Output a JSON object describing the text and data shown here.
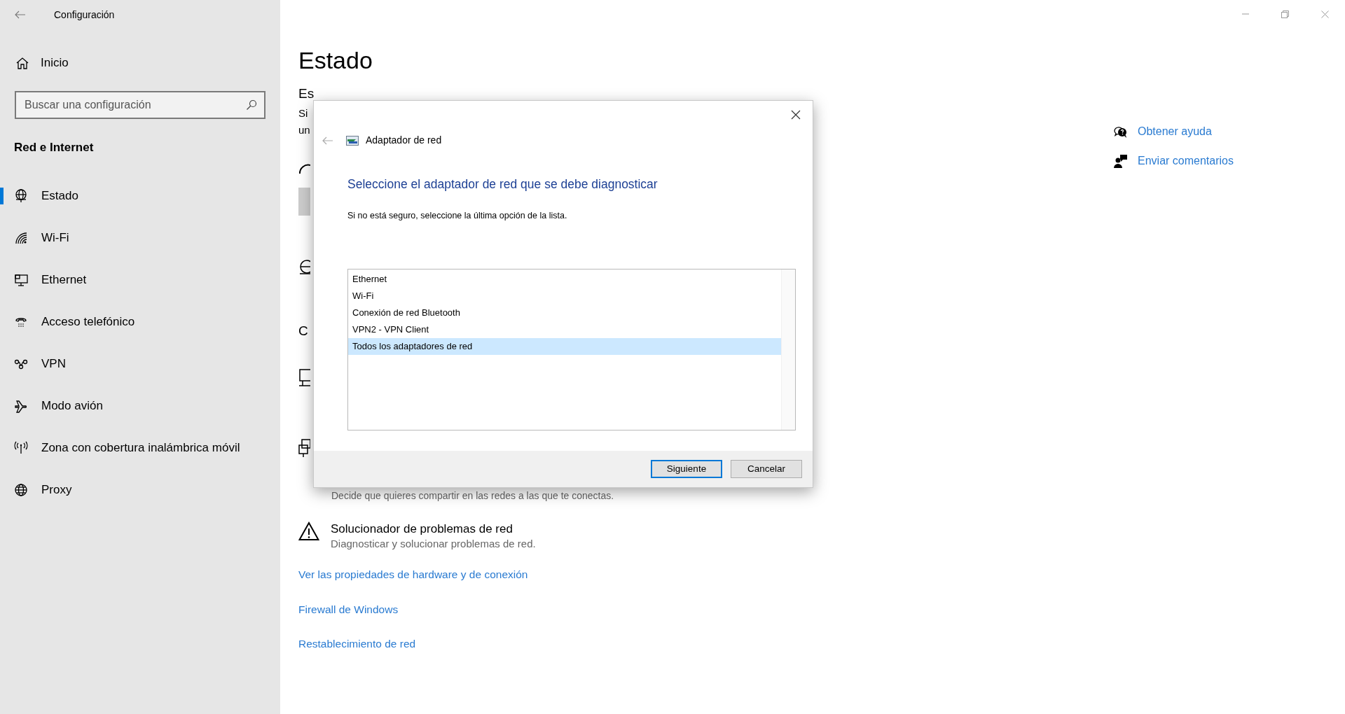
{
  "window": {
    "title": "Configuración"
  },
  "sidebar": {
    "home": "Inicio",
    "search": {
      "placeholder": "Buscar una configuración"
    },
    "section": "Red e Internet",
    "items": [
      {
        "label": "Estado",
        "selected": true
      },
      {
        "label": "Wi-Fi",
        "selected": false
      },
      {
        "label": "Ethernet",
        "selected": false
      },
      {
        "label": "Acceso telefónico",
        "selected": false
      },
      {
        "label": "VPN",
        "selected": false
      },
      {
        "label": "Modo avión",
        "selected": false
      },
      {
        "label": "Zona con cobertura inalámbrica móvil",
        "selected": false
      },
      {
        "label": "Proxy",
        "selected": false
      }
    ]
  },
  "main": {
    "title": "Estado",
    "covered_fragments": [
      "Es",
      "Si",
      "un",
      "C"
    ],
    "sharing_hint": "Decide que quieres compartir en las redes a las que te conectas.",
    "troubleshooter": {
      "title": "Solucionador de problemas de red",
      "description": "Diagnosticar y solucionar problemas de red."
    },
    "links": [
      "Ver las propiedades de hardware y de conexión",
      "Firewall de Windows",
      "Restablecimiento de red"
    ]
  },
  "related": [
    {
      "label": "Obtener ayuda"
    },
    {
      "label": "Enviar comentarios"
    }
  ],
  "dialog": {
    "title": "Adaptador de red",
    "heading": "Seleccione el adaptador de red que se debe diagnosticar",
    "instruction": "Si no está seguro, seleccione la última opción de la lista.",
    "adapters": [
      {
        "label": "Ethernet",
        "selected": false
      },
      {
        "label": "Wi-Fi",
        "selected": false
      },
      {
        "label": "Conexión de red Bluetooth",
        "selected": false
      },
      {
        "label": "VPN2 - VPN Client",
        "selected": false
      },
      {
        "label": "Todos los adaptadores de red",
        "selected": true
      }
    ],
    "buttons": [
      {
        "label": "Siguiente",
        "default": true
      },
      {
        "label": "Cancelar",
        "default": false
      }
    ]
  }
}
